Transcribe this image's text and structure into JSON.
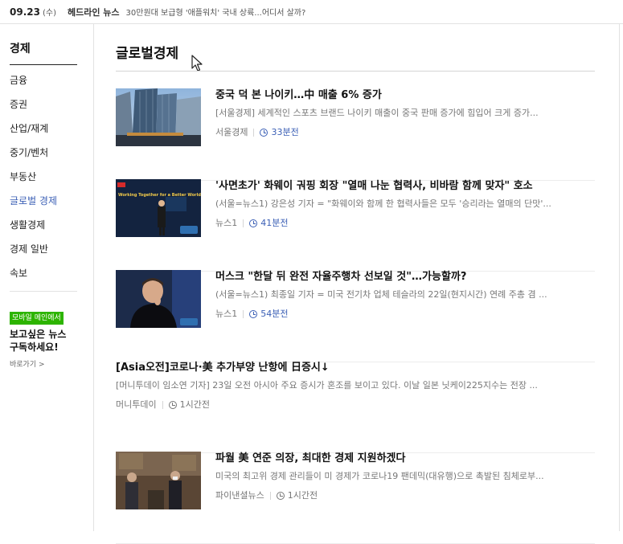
{
  "top": {
    "date": "09.23",
    "weekday": "(수)",
    "headline_label": "헤드라인 뉴스",
    "headline_text": "30만원대 보급형 '애플워치' 국내 상륙...어디서 살까?"
  },
  "sidebar": {
    "title": "경제",
    "items": [
      {
        "label": "금융"
      },
      {
        "label": "증권"
      },
      {
        "label": "산업/재계"
      },
      {
        "label": "중기/벤처"
      },
      {
        "label": "부동산"
      },
      {
        "label": "글로벌 경제"
      },
      {
        "label": "생활경제"
      },
      {
        "label": "경제 일반"
      },
      {
        "label": "속보"
      }
    ],
    "active_index": 5,
    "promo_badge": "모바일 메인에서",
    "promo_line1": "보고싶은 뉴스",
    "promo_line2": "구독하세요!",
    "promo_link": "바로가기 >"
  },
  "main": {
    "title": "글로벌경제",
    "articles": [
      {
        "title": "중국 덕 본 나이키…中 매출 6% 증가",
        "summary": "[서울경제] 세계적인 스포츠 브랜드 나이키 매출이 중국 판매 증가에 힘입어 크게 증가...",
        "source": "서울경제",
        "time": "33분전"
      },
      {
        "title": "'사면초가' 화웨이 궈핑 회장 \"열매 나눈 협력사, 비바람 함께 맞자\" 호소",
        "summary": "(서울=뉴스1) 강은성 기자 = \"화웨이와 함께 한 협력사들은 모두 '승리라는 열매의 단맛'...",
        "source": "뉴스1",
        "time": "41분전",
        "thumb_caption": "Working Together for a Better World"
      },
      {
        "title": "머스크 \"한달 뒤 완전 자율주행차 선보일 것\"…가능할까?",
        "summary": "(서울=뉴스1) 최종일 기자 = 미국 전기차 업체 테슬라의 22일(현지시간) 연례 주총 겸 ...",
        "source": "뉴스1",
        "time": "54분전"
      },
      {
        "title": "[Asia오전]코로나·美 추가부양 난항에 日증시↓",
        "summary": "[머니투데이 임소연 기자] 23일 오전 아시아 주요 증시가 혼조를 보이고 있다. 이날 일본 닛케이225지수는 전장 ...",
        "source": "머니투데이",
        "time": "1시간전"
      },
      {
        "title": "파월 美 연준 의장, 최대한 경제 지원하겠다",
        "summary": "미국의 최고위 경제 관리들이 미 경제가 코로나19 팬데믹(대유행)으로 촉발된 침체로부...",
        "source": "파이낸셜뉴스",
        "time": "1시간전"
      }
    ]
  },
  "colors": {
    "accent_blue": "#3b5fb5",
    "promo_green": "#2db400"
  }
}
